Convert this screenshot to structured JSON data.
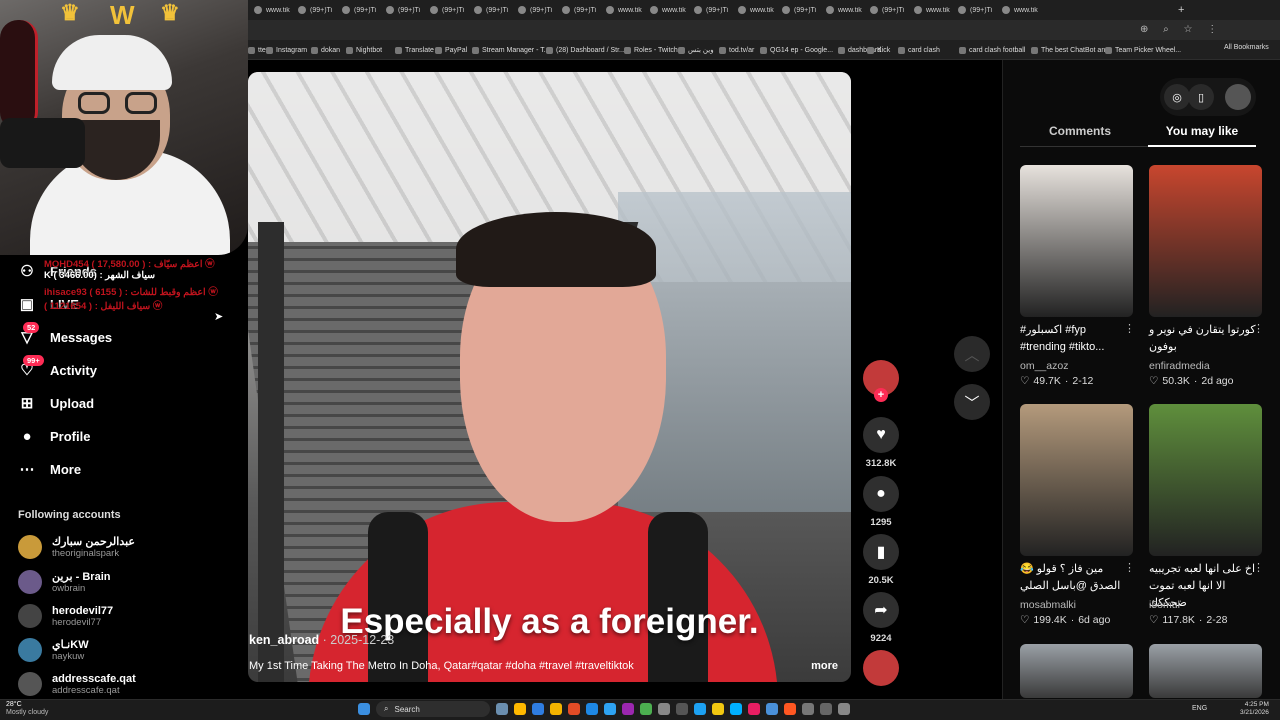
{
  "browser": {
    "tabs": [
      "www.tik",
      "(99+)Ti",
      "(99+)Ti",
      "(99+)Ti",
      "(99+)Ti",
      "(99+)Ti",
      "(99+)Ti",
      "(99+)Ti",
      "www.tik",
      "www.tik",
      "(99+)Ti",
      "www.tik",
      "(99+)Ti",
      "www.tik",
      "(99+)Ti",
      "www.tik",
      "(99+)Ti",
      "www.tik"
    ],
    "bookmarks": [
      "tter",
      "Instagram",
      "dokan",
      "Nightbot",
      "Translate",
      "PayPal",
      "Stream Manager - T...",
      "(28) Dashboard / Str...",
      "Roles - Twitch",
      "وين بتس",
      "tod.tv/ar",
      "QG14 ep - Google...",
      "dashboard",
      "Kick",
      "card clash",
      "card clash football",
      "The best ChatBot an...",
      "Team Picker Wheel..."
    ],
    "all_bookmarks": "All Bookmarks"
  },
  "stream_overlay": {
    "lines": [
      {
        "text": "MOHD454 ( 17,580.00 ) : اعظم سيّاف ⓦ",
        "color": "#c0131d"
      },
      {
        "text": "K ( 3466.00) : سياف الشهر",
        "color": "#ffffff"
      },
      {
        "text": "ihisace93 ( 6155 ) : اعظم وقبط للشات ⓦ",
        "color": "#c0131d"
      },
      {
        "text": "( 1121654 ) : سياف الليفل ⓦ",
        "color": "#c0131d"
      }
    ]
  },
  "sidebar": {
    "items": [
      {
        "label": "Friends",
        "icon": "friends-icon"
      },
      {
        "label": "LIVE",
        "icon": "live-icon"
      },
      {
        "label": "Messages",
        "icon": "messages-icon",
        "badge": "52"
      },
      {
        "label": "Activity",
        "icon": "activity-icon",
        "badge": "99+"
      },
      {
        "label": "Upload",
        "icon": "upload-icon"
      },
      {
        "label": "Profile",
        "icon": "profile-avatar"
      },
      {
        "label": "More",
        "icon": "more-icon"
      }
    ],
    "following_title": "Following accounts",
    "accounts": [
      {
        "name": "عبدالرحمن سبارك",
        "user": "theoriginalspark",
        "color": "#c99a3a"
      },
      {
        "name": "برين - Brain",
        "user": "owbrain",
        "color": "#6b5a8a"
      },
      {
        "name": "herodevil77",
        "user": "herodevil77",
        "color": "#444444"
      },
      {
        "name": "نـايKW",
        "user": "naykuw",
        "color": "#3a7aa0"
      },
      {
        "name": "addresscafe.qat",
        "user": "addresscafe.qat",
        "color": "#555555"
      }
    ]
  },
  "video": {
    "caption": "Especially as a foreigner.",
    "author": "ken_abroad",
    "date": " · 2025-12-23",
    "description": "My 1st Time Taking The Metro In Doha, Qatar#qatar #doha #travel #traveltiktok",
    "more": "more"
  },
  "actions": {
    "likes": "312.8K",
    "comments": "1295",
    "saves": "20.5K",
    "shares": "9224"
  },
  "right_panel": {
    "tabs": [
      "Comments",
      "You may like"
    ],
    "active_tab": "You may like",
    "cards": [
      {
        "title": "#اكسبلور #fyp #trending #tikto...",
        "author": "om__azoz",
        "likes": "49.7K",
        "date": "2-12",
        "color": "#e7e2dd"
      },
      {
        "title": "كورتوا يتقارن في نوير و بوفون",
        "author": "enfiradmedia",
        "likes": "50.3K",
        "date": "2d ago",
        "color": "#c8462e"
      },
      {
        "title": "😂 مين فاز ؟ قولو الصدق @باسل الصلي",
        "author": "mosabmalki",
        "likes": "199.4K",
        "date": "6d ago",
        "color": "#b49a7c"
      },
      {
        "title": "اخ على انها لعبه تجريبيه الا انها لعبه تموت ضحككك",
        "author": "i5omul",
        "likes": "117.8K",
        "date": "2-28",
        "color": "#5f8f3c"
      }
    ]
  },
  "taskbar": {
    "weather_temp": "28°C",
    "weather_desc": "Mostly cloudy",
    "search": "Search",
    "lang": "ENG",
    "time": "4:25 PM",
    "date": "3/21/2026"
  }
}
